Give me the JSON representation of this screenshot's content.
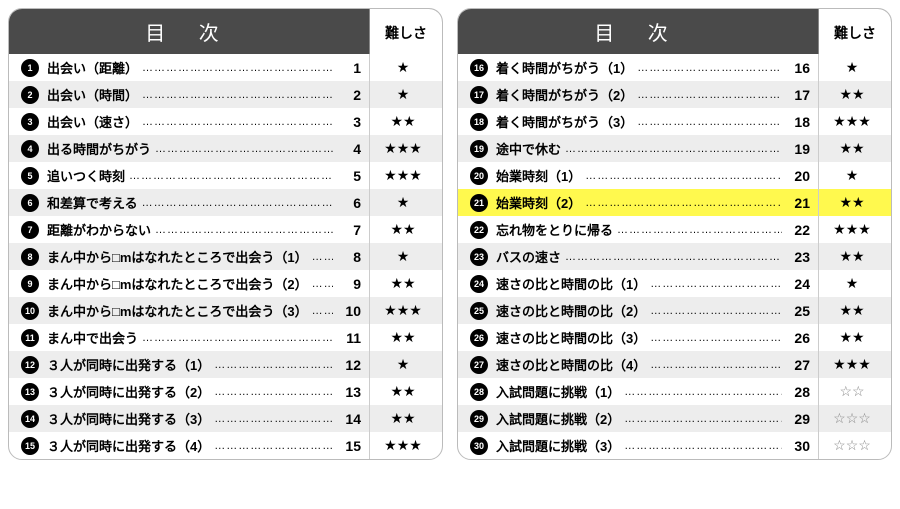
{
  "header": {
    "title": "目 次",
    "difficulty": "難しさ"
  },
  "columns": [
    {
      "rows": [
        {
          "n": 1,
          "title": "出会い（距離）",
          "page": 1,
          "stars": 1,
          "shade": false
        },
        {
          "n": 2,
          "title": "出会い（時間）",
          "page": 2,
          "stars": 1,
          "shade": true
        },
        {
          "n": 3,
          "title": "出会い（速さ）",
          "page": 3,
          "stars": 2,
          "shade": false
        },
        {
          "n": 4,
          "title": "出る時間がちがう",
          "page": 4,
          "stars": 3,
          "shade": true
        },
        {
          "n": 5,
          "title": "追いつく時刻",
          "page": 5,
          "stars": 3,
          "shade": false
        },
        {
          "n": 6,
          "title": "和差算で考える",
          "page": 6,
          "stars": 1,
          "shade": true
        },
        {
          "n": 7,
          "title": "距離がわからない",
          "page": 7,
          "stars": 2,
          "shade": false
        },
        {
          "n": 8,
          "title": "まん中から□mはなれたところで出会う（1）",
          "page": 8,
          "stars": 1,
          "shade": true
        },
        {
          "n": 9,
          "title": "まん中から□mはなれたところで出会う（2）",
          "page": 9,
          "stars": 2,
          "shade": false
        },
        {
          "n": 10,
          "title": "まん中から□mはなれたところで出会う（3）",
          "page": 10,
          "stars": 3,
          "shade": true
        },
        {
          "n": 11,
          "title": "まん中で出会う",
          "page": 11,
          "stars": 2,
          "shade": false
        },
        {
          "n": 12,
          "title": "３人が同時に出発する（1）",
          "page": 12,
          "stars": 1,
          "shade": true
        },
        {
          "n": 13,
          "title": "３人が同時に出発する（2）",
          "page": 13,
          "stars": 2,
          "shade": false
        },
        {
          "n": 14,
          "title": "３人が同時に出発する（3）",
          "page": 14,
          "stars": 2,
          "shade": true
        },
        {
          "n": 15,
          "title": "３人が同時に出発する（4）",
          "page": 15,
          "stars": 3,
          "shade": false
        }
      ]
    },
    {
      "rows": [
        {
          "n": 16,
          "title": "着く時間がちがう（1）",
          "page": 16,
          "stars": 1,
          "shade": false
        },
        {
          "n": 17,
          "title": "着く時間がちがう（2）",
          "page": 17,
          "stars": 2,
          "shade": true
        },
        {
          "n": 18,
          "title": "着く時間がちがう（3）",
          "page": 18,
          "stars": 3,
          "shade": false
        },
        {
          "n": 19,
          "title": "途中で休む",
          "page": 19,
          "stars": 2,
          "shade": true
        },
        {
          "n": 20,
          "title": "始業時刻（1）",
          "page": 20,
          "stars": 1,
          "shade": false
        },
        {
          "n": 21,
          "title": "始業時刻（2）",
          "page": 21,
          "stars": 2,
          "shade": false,
          "highlight": true
        },
        {
          "n": 22,
          "title": "忘れ物をとりに帰る",
          "page": 22,
          "stars": 3,
          "shade": false
        },
        {
          "n": 23,
          "title": "バスの速さ",
          "page": 23,
          "stars": 2,
          "shade": true
        },
        {
          "n": 24,
          "title": "速さの比と時間の比（1）",
          "page": 24,
          "stars": 1,
          "shade": false
        },
        {
          "n": 25,
          "title": "速さの比と時間の比（2）",
          "page": 25,
          "stars": 2,
          "shade": true
        },
        {
          "n": 26,
          "title": "速さの比と時間の比（3）",
          "page": 26,
          "stars": 2,
          "shade": false
        },
        {
          "n": 27,
          "title": "速さの比と時間の比（4）",
          "page": 27,
          "stars": 3,
          "shade": true
        },
        {
          "n": 28,
          "title": "入試問題に挑戦（1）",
          "page": 28,
          "stars": 2,
          "open": true,
          "shade": false
        },
        {
          "n": 29,
          "title": "入試問題に挑戦（2）",
          "page": 29,
          "stars": 3,
          "open": true,
          "shade": true
        },
        {
          "n": 30,
          "title": "入試問題に挑戦（3）",
          "page": 30,
          "stars": 3,
          "open": true,
          "shade": false
        }
      ]
    }
  ]
}
